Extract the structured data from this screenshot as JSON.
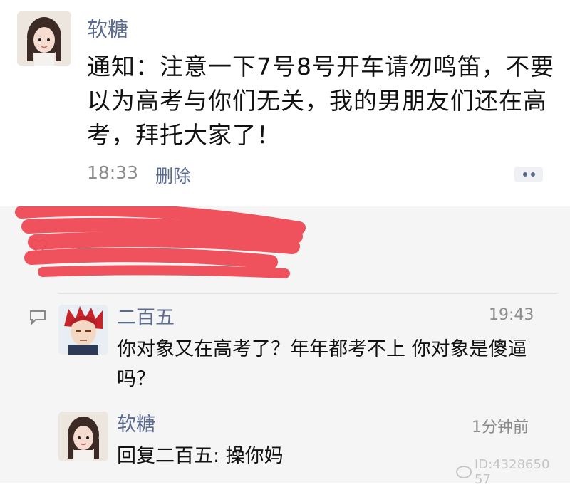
{
  "post": {
    "author": "软糖",
    "text": "通知：注意一下7号8号开车请勿鸣笛，不要以为高考与你们无关，我的男朋友们还在高考，拜托大家了！",
    "time": "18:33",
    "delete_label": "删除"
  },
  "comments": [
    {
      "author": "二百五",
      "time": "19:43",
      "text": "你对象又在高考了？年年都考不上 你对象是傻逼吗？"
    },
    {
      "author": "软糖",
      "time": "1分钟前",
      "text": "回复二百五: 操你妈"
    }
  ],
  "watermark": "ID:4328650 57",
  "colors": {
    "name_blue": "#5a6b8f",
    "scribble_red": "#f04a55",
    "comment_bg": "#f5f5f5"
  }
}
